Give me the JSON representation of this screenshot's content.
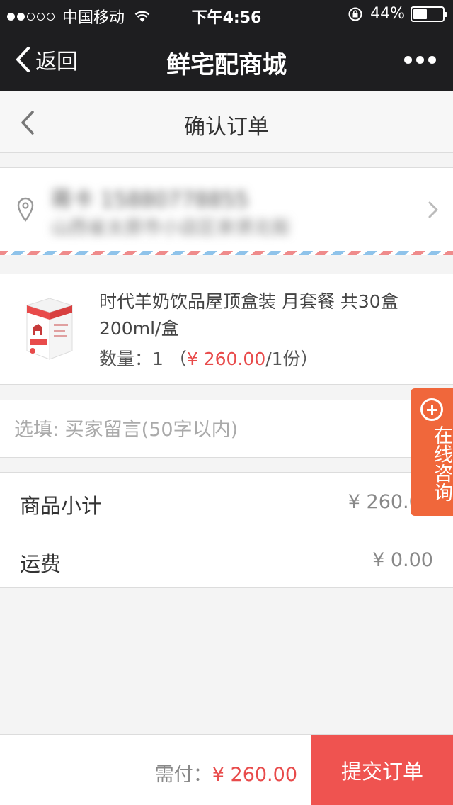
{
  "status_bar": {
    "carrier": "中国移动",
    "time": "下午4:56",
    "battery": "44%",
    "battery_level": 0.44
  },
  "wechat_header": {
    "back_label": "返回",
    "title": "鲜宅配商城"
  },
  "page": {
    "title": "确认订单"
  },
  "address": {
    "name_phone": "蒋卡 15880778855",
    "detail": "山西省太原市小店区亲贤北街"
  },
  "product": {
    "name": "时代羊奶饮品屋顶盒装 月套餐 共30盒 200ml/盒",
    "qty_label": "数量：",
    "qty": "1",
    "price_open": "（",
    "price": "¥ 260.00",
    "price_unit": "/1份）"
  },
  "message": {
    "placeholder": "选填: 买家留言(50字以内)"
  },
  "summary": {
    "subtotal_label": "商品小计",
    "subtotal_value": "¥ 260.00",
    "shipping_label": "运费",
    "shipping_value": "¥ 0.00"
  },
  "consult": {
    "label": "在线咨询"
  },
  "bottom": {
    "need_pay_label": "需付：",
    "need_pay_value": "¥ 260.00",
    "submit_label": "提交订单"
  },
  "colors": {
    "accent_red": "#ef5350",
    "consult_orange": "#f0673b",
    "header_bg": "#1e1e20"
  },
  "icons": [
    "signal-dots-icon",
    "wifi-icon",
    "rotation-lock-icon",
    "battery-icon",
    "back-chevron-icon",
    "more-dots-icon",
    "location-pin-icon",
    "chevron-right-icon",
    "plus-circle-icon"
  ]
}
